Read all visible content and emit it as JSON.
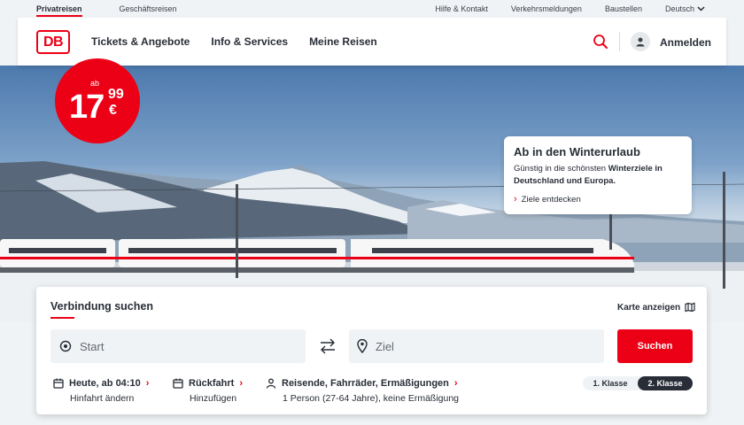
{
  "utility": {
    "left": [
      {
        "label": "Privatreisen",
        "active": true
      },
      {
        "label": "Geschäftsreisen",
        "active": false
      }
    ],
    "right": [
      "Hilfe & Kontakt",
      "Verkehrsmeldungen",
      "Baustellen"
    ],
    "language": "Deutsch"
  },
  "header": {
    "logo": "DB",
    "nav": [
      "Tickets & Angebote",
      "Info & Services",
      "Meine Reisen"
    ],
    "login": "Anmelden"
  },
  "hero": {
    "price": {
      "prefix": "ab",
      "euros": "17",
      "cents": "99",
      "currency": "€"
    },
    "promo": {
      "title": "Ab in den Winterurlaub",
      "text_before": "Günstig in die schönsten ",
      "text_bold": "Winterziele in Deutschland und Europa.",
      "link": "Ziele entdecken"
    }
  },
  "search": {
    "title": "Verbindung suchen",
    "map_link": "Karte anzeigen",
    "start_placeholder": "Start",
    "ziel_placeholder": "Ziel",
    "submit": "Suchen",
    "options": [
      {
        "head": "Heute, ab 04:10",
        "sub": "Hinfahrt ändern"
      },
      {
        "head": "Rückfahrt",
        "sub": "Hinzufügen"
      },
      {
        "head": "Reisende, Fahrräder, Ermäßigungen",
        "sub": "1 Person (27-64 Jahre), keine Ermäßigung"
      }
    ],
    "classes": [
      "1. Klasse",
      "2. Klasse"
    ],
    "selected_class": "2. Klasse"
  },
  "colors": {
    "accent": "#ec0016",
    "text": "#282d37",
    "surface": "#f0f3f5"
  }
}
